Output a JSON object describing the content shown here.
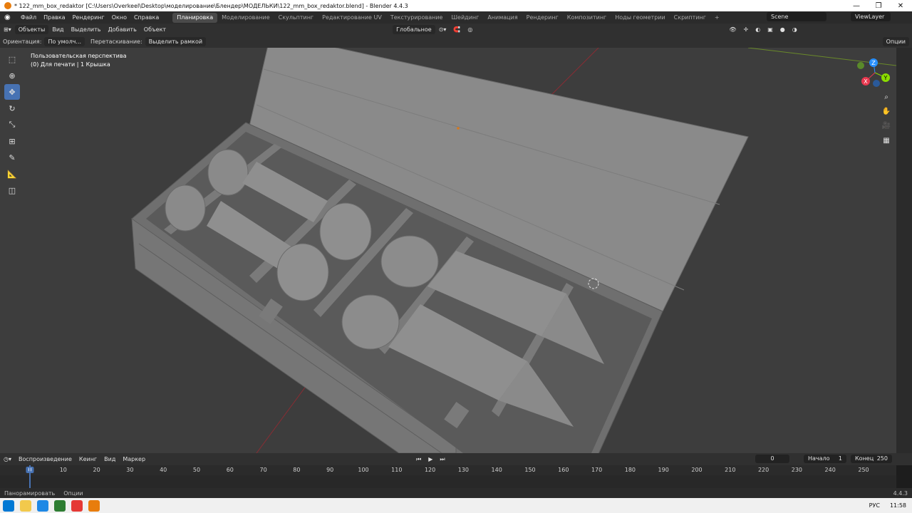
{
  "window": {
    "title": "* 122_mm_box_redaktor [C:\\Users\\Overkeel\\Desktop\\моделирование\\Блендер\\МОДЕЛЬКИ\\122_mm_box_redaktor.blend] - Blender 4.4.3",
    "minimize": "—",
    "maximize": "❐",
    "close": "✕"
  },
  "menu": [
    "Файл",
    "Правка",
    "Рендеринг",
    "Окно",
    "Справка"
  ],
  "workspaces": [
    "Планировка",
    "Моделирование",
    "Скульптинг",
    "Редактирование UV",
    "Текстурирование",
    "Шейдинг",
    "Анимация",
    "Рендеринг",
    "Композитинг",
    "Ноды геометрии",
    "Скриптинг"
  ],
  "workspace_add": "+",
  "scene": "Scene",
  "view_layer": "ViewLayer",
  "viewport_header": {
    "mode": "Объекты",
    "view": "Вид",
    "select": "Выделить",
    "add": "Добавить",
    "object": "Объект",
    "transform_orientation": "Глобальное"
  },
  "tool_settings": {
    "orientation_label": "Ориентация:",
    "orientation_value": "По умолч...",
    "drag_label": "Перетаскивание:",
    "drag_value": "Выделить рамкой",
    "options": "Опции"
  },
  "viewport_info": {
    "line1": "Пользовательская перспектива",
    "line2": "(0) Для печати | 1 Крышка"
  },
  "gizmo": {
    "x": "X",
    "y": "Y",
    "z": "Z"
  },
  "timeline": {
    "playback": "Воспроизведение",
    "keying": "Кеинг",
    "view": "Вид",
    "marker": "Маркер",
    "current_frame": "0",
    "start_label": "Начало",
    "start_value": "1",
    "end_label": "Конец",
    "end_value": "250",
    "ticks": [
      "0",
      "10",
      "20",
      "30",
      "40",
      "50",
      "60",
      "70",
      "80",
      "90",
      "100",
      "110",
      "120",
      "130",
      "140",
      "150",
      "160",
      "170",
      "180",
      "190",
      "200",
      "210",
      "220",
      "230",
      "240",
      "250"
    ]
  },
  "statusbar": {
    "pan": "Панорамировать",
    "options": "Опции",
    "version": "4.4.3"
  },
  "taskbar": {
    "lang": "РУС",
    "time": "11:58"
  },
  "colors": {
    "accent": "#4772b3",
    "active_tool": "#4772b3",
    "axis_x": "#e8384f",
    "axis_y": "#8bdc00",
    "axis_z": "#2890ff"
  }
}
